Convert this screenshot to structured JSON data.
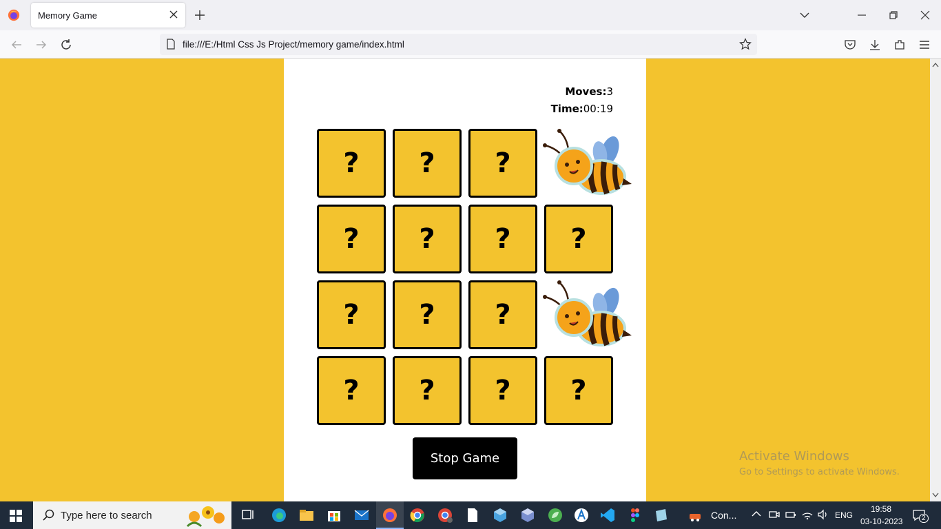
{
  "browser": {
    "tab_title": "Memory Game",
    "url": "file:///E:/Html Css Js Project/memory game/index.html"
  },
  "game": {
    "moves_label": "Moves:",
    "moves_value": "3",
    "time_label": "Time:",
    "time_value": "00:19",
    "hidden_symbol": "?",
    "stop_button": "Stop Game",
    "tiles": [
      "hidden",
      "hidden",
      "hidden",
      "bee",
      "hidden",
      "hidden",
      "hidden",
      "hidden",
      "hidden",
      "hidden",
      "hidden",
      "bee",
      "hidden",
      "hidden",
      "hidden",
      "hidden"
    ],
    "colors": {
      "background": "#f3c32e",
      "panel": "#ffffff",
      "button": "#000000"
    }
  },
  "watermark": {
    "line1": "Activate Windows",
    "line2": "Go to Settings to activate Windows."
  },
  "taskbar": {
    "search_placeholder": "Type here to search",
    "pinned_label": "Con...",
    "language": "ENG",
    "time": "19:58",
    "date": "03-10-2023",
    "notifications": "2"
  }
}
